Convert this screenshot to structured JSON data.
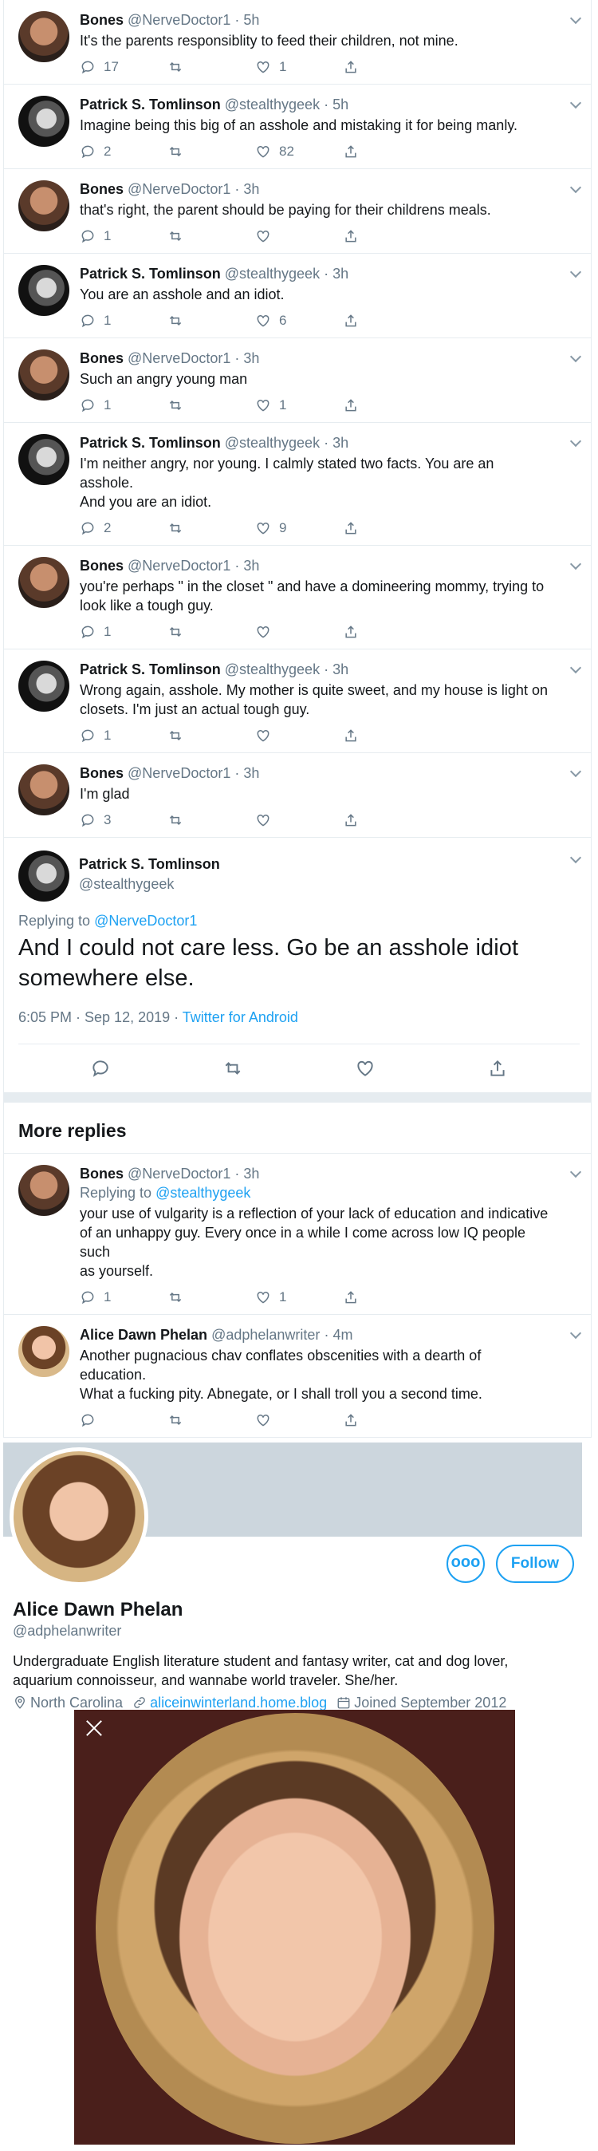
{
  "replies_top": [
    {
      "kind": "bones",
      "name": "Bones",
      "handle": "@NerveDoctor1",
      "time": "5h",
      "text": "It's the parents responsiblity to feed their children, not mine.",
      "reply": "17",
      "retweet": "",
      "like": "1"
    },
    {
      "kind": "patrick",
      "name": "Patrick S. Tomlinson",
      "handle": "@stealthygeek",
      "time": "5h",
      "text": "Imagine being this big of an asshole and mistaking it for being manly.",
      "reply": "2",
      "retweet": "",
      "like": "82"
    },
    {
      "kind": "bones",
      "name": "Bones",
      "handle": "@NerveDoctor1",
      "time": "3h",
      "text": "that's right, the parent should be paying for their childrens meals.",
      "reply": "1",
      "retweet": "",
      "like": ""
    },
    {
      "kind": "patrick",
      "name": "Patrick S. Tomlinson",
      "handle": "@stealthygeek",
      "time": "3h",
      "text": "You are an asshole and an idiot.",
      "reply": "1",
      "retweet": "",
      "like": "6"
    },
    {
      "kind": "bones",
      "name": "Bones",
      "handle": "@NerveDoctor1",
      "time": "3h",
      "text": "Such an angry young man",
      "reply": "1",
      "retweet": "",
      "like": "1"
    },
    {
      "kind": "patrick",
      "name": "Patrick S. Tomlinson",
      "handle": "@stealthygeek",
      "time": "3h",
      "text": "I'm neither angry, nor young. I calmly stated two facts. You are an asshole.\nAnd you are an idiot.",
      "reply": "2",
      "retweet": "",
      "like": "9"
    },
    {
      "kind": "bones",
      "name": "Bones",
      "handle": "@NerveDoctor1",
      "time": "3h",
      "text": "you're perhaps \" in the closet \" and have a domineering mommy, trying to\nlook like a tough guy.",
      "reply": "1",
      "retweet": "",
      "like": ""
    },
    {
      "kind": "patrick",
      "name": "Patrick S. Tomlinson",
      "handle": "@stealthygeek",
      "time": "3h",
      "text": "Wrong again, asshole. My mother is quite sweet, and my house is light on\nclosets. I'm just an actual tough guy.",
      "reply": "1",
      "retweet": "",
      "like": ""
    },
    {
      "kind": "bones",
      "name": "Bones",
      "handle": "@NerveDoctor1",
      "time": "3h",
      "text": "I'm glad",
      "reply": "3",
      "retweet": "",
      "like": ""
    }
  ],
  "main_tweet": {
    "name": "Patrick S. Tomlinson",
    "handle": "@stealthygeek",
    "replying_prefix": "Replying to",
    "replying_to": "@NerveDoctor1",
    "text": "And I could not care less. Go be an asshole idiot\nsomewhere else.",
    "timestamp": "6:05 PM · Sep 12, 2019 · ",
    "source": "Twitter for Android"
  },
  "more_replies_title": "More replies",
  "replies_more": [
    {
      "kind": "bones",
      "name": "Bones",
      "handle": "@NerveDoctor1",
      "time": "3h",
      "replying_prefix": "Replying to",
      "replying_to": "@stealthygeek",
      "text": "your use of vulgarity is a reflection of your lack of education and indicative\nof an unhappy guy. Every once in a while I come across low IQ people such\nas yourself.",
      "reply": "1",
      "retweet": "",
      "like": "1"
    },
    {
      "kind": "alice",
      "name": "Alice Dawn Phelan",
      "handle": "@adphelanwriter",
      "time": "4m",
      "replying_prefix": "",
      "replying_to": "",
      "text": "Another pugnacious chav conflates obscenities with a dearth of education.\nWhat a fucking pity. Abnegate, or I shall troll you a second time.",
      "reply": "",
      "retweet": "",
      "like": ""
    }
  ],
  "profile": {
    "more_label": "ooo",
    "follow_label": "Follow",
    "name": "Alice Dawn Phelan",
    "handle": "@adphelanwriter",
    "bio": "Undergraduate English literature student and fantasy writer, cat and dog lover, aquarium connoisseur, and wannabe world traveler. She/her.",
    "location": "North Carolina",
    "website": "aliceinwinterland.home.blog",
    "joined": "Joined September 2012"
  },
  "colors": {
    "accent": "#1da1f2",
    "muted": "#657786",
    "border": "#e6ecf0",
    "banner": "#ccd6dd",
    "viewer_bg": "#4a1f1b"
  }
}
